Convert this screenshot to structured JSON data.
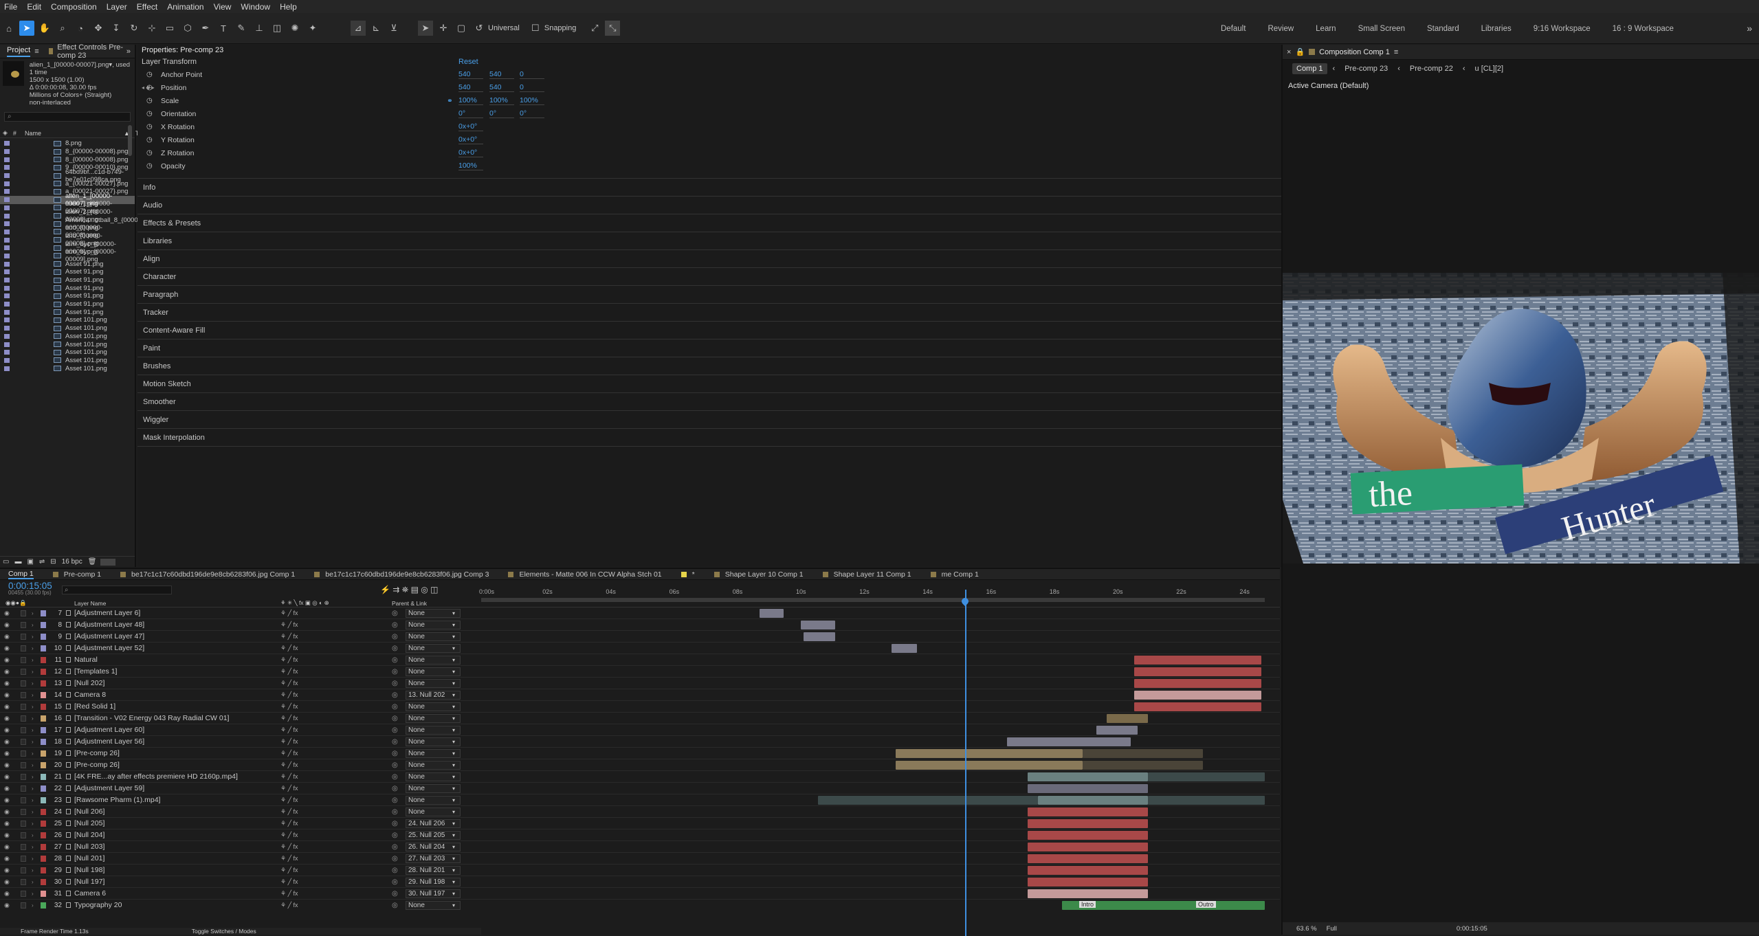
{
  "menu": [
    "File",
    "Edit",
    "Composition",
    "Layer",
    "Effect",
    "Animation",
    "View",
    "Window",
    "Help"
  ],
  "toolbar": {
    "universal": "Universal",
    "snapping": "Snapping"
  },
  "workspaces": [
    "Default",
    "Review",
    "Learn",
    "Small Screen",
    "Standard",
    "Libraries",
    "9:16 Workspace",
    "16 : 9 Workspace"
  ],
  "project": {
    "tab": "Project",
    "tab2": "Effect Controls Pre-comp 23",
    "info": [
      "alien_1_[00000-00007].png▾, used 1 time",
      "1500 x 1500 (1.00)",
      "Δ 0:00:00:08, 30.00 fps",
      "Millions of Colors+ (Straight)",
      "non-interlaced"
    ],
    "search": "",
    "col_name": "Name",
    "col_type": "Type",
    "items": [
      "8.png",
      "8_{00000-00008}.png",
      "8_{00000-00008}.png",
      "9_{00000-00010}.png",
      "64bd9bf...c1d-b749-be7e01c098ca.png",
      "a_{00021-00027}.png",
      "a_{00021-00027}.png",
      "alien_1_[00000-00007].png",
      "alien_1_[00000-00007].png",
      "alien_2_{00000-00008}.png",
      "America...otball_8_{00000-00008}.png",
      "and_{00000-00008}.png",
      "and_{00000-00008}.png",
      "arm_byc_[00000-00009].png",
      "arm_byc_[00000-00009].png",
      "Asset 91.png",
      "Asset 91.png",
      "Asset 91.png",
      "Asset 91.png",
      "Asset 91.png",
      "Asset 91.png",
      "Asset 91.png",
      "Asset 101.png",
      "Asset 101.png",
      "Asset 101.png",
      "Asset 101.png",
      "Asset 101.png",
      "Asset 101.png",
      "Asset 101.png"
    ],
    "selected_index": 7,
    "bpc": "16 bpc"
  },
  "properties": {
    "title": "Properties: Pre-comp 23",
    "group": "Layer Transform",
    "reset": "Reset",
    "rows": [
      {
        "name": "Anchor Point",
        "v": [
          "540",
          "540",
          "0"
        ]
      },
      {
        "name": "Position",
        "v": [
          "540",
          "540",
          "0"
        ]
      },
      {
        "name": "Scale",
        "v": [
          "100%",
          "100%",
          "100%"
        ]
      },
      {
        "name": "Orientation",
        "v": [
          "0°",
          "0°",
          "0°"
        ]
      },
      {
        "name": "X Rotation",
        "v": [
          "0x+0°"
        ]
      },
      {
        "name": "Y Rotation",
        "v": [
          "0x+0°"
        ]
      },
      {
        "name": "Z Rotation",
        "v": [
          "0x+0°"
        ]
      },
      {
        "name": "Opacity",
        "v": [
          "100%"
        ]
      }
    ],
    "sections": [
      "Info",
      "Audio",
      "Effects & Presets",
      "Libraries",
      "Align",
      "Character",
      "Paragraph",
      "Tracker",
      "Content-Aware Fill",
      "Paint",
      "Brushes",
      "Motion Sketch",
      "Smoother",
      "Wiggler",
      "Mask Interpolation"
    ]
  },
  "composition": {
    "tab": "Composition Comp 1",
    "breadcrumbs": [
      "Comp 1",
      "Pre-comp 23",
      "Pre-comp 22",
      "u [CL][2]"
    ],
    "camera": "Active Camera (Default)",
    "text_the": "the",
    "text_hunter": "Hunter",
    "footer_zoom": "63.6 %",
    "footer_res": "Full",
    "footer_time": "0:00:15:05"
  },
  "timeline": {
    "tabs": [
      "Comp 1",
      "Pre-comp 1",
      "be17c1c17c60dbd196de9e8cb6283f06.jpg Comp 1",
      "be17c1c17c60dbd196de9e8cb6283f06.jpg Comp 3",
      "Elements - Matte 006 In CCW Alpha Stch 01",
      "*",
      "Shape Layer 10 Comp 1",
      "Shape Layer 11 Comp 1",
      "me Comp 1"
    ],
    "timecode": "0:00:15:05",
    "frames": "00455 (30.00 fps)",
    "col_layer": "Layer Name",
    "col_parent": "Parent & Link",
    "ruler": [
      "0:00s",
      "02s",
      "04s",
      "06s",
      "08s",
      "10s",
      "12s",
      "14s",
      "16s",
      "18s",
      "20s",
      "22s",
      "24s"
    ],
    "footer": "Frame Render Time 1.13s",
    "footer2": "Toggle Switches / Modes",
    "layers": [
      {
        "n": "7",
        "name": "[Adjustment Layer 6]",
        "parent": "None",
        "c": "#8e8ec8"
      },
      {
        "n": "8",
        "name": "[Adjustment Layer 48]",
        "parent": "None",
        "c": "#8e8ec8"
      },
      {
        "n": "9",
        "name": "[Adjustment Layer 47]",
        "parent": "None",
        "c": "#8e8ec8"
      },
      {
        "n": "10",
        "name": "[Adjustment Layer 52]",
        "parent": "None",
        "c": "#8e8ec8"
      },
      {
        "n": "11",
        "name": "Natural",
        "parent": "None",
        "c": "#b23b3b"
      },
      {
        "n": "12",
        "name": "[Templates 1]",
        "parent": "None",
        "c": "#b23b3b"
      },
      {
        "n": "13",
        "name": "[Null 202]",
        "parent": "None",
        "c": "#b23b3b"
      },
      {
        "n": "14",
        "name": "Camera 8",
        "parent": "13. Null 202",
        "c": "#e09090"
      },
      {
        "n": "15",
        "name": "[Red Solid 1]",
        "parent": "None",
        "c": "#b23b3b"
      },
      {
        "n": "16",
        "name": "[Transition - V02 Energy 043 Ray Radial CW 01]",
        "parent": "None",
        "c": "#c8a36b"
      },
      {
        "n": "17",
        "name": "[Adjustment Layer 60]",
        "parent": "None",
        "c": "#8e8ec8"
      },
      {
        "n": "18",
        "name": "[Adjustment Layer 56]",
        "parent": "None",
        "c": "#8e8ec8"
      },
      {
        "n": "19",
        "name": "[Pre-comp 26]",
        "parent": "None",
        "c": "#c8a36b"
      },
      {
        "n": "20",
        "name": "[Pre-comp 26]",
        "parent": "None",
        "c": "#c8a36b"
      },
      {
        "n": "21",
        "name": "[4K FRE...ay after effects premiere HD 2160p.mp4]",
        "parent": "None",
        "c": "#8cb8b8"
      },
      {
        "n": "22",
        "name": "[Adjustment Layer 59]",
        "parent": "None",
        "c": "#8e8ec8"
      },
      {
        "n": "23",
        "name": "[Rawsome Pharm (1).mp4]",
        "parent": "None",
        "c": "#8cb8b8"
      },
      {
        "n": "24",
        "name": "[Null 206]",
        "parent": "None",
        "c": "#b23b3b"
      },
      {
        "n": "25",
        "name": "[Null 205]",
        "parent": "24. Null 206",
        "c": "#b23b3b"
      },
      {
        "n": "26",
        "name": "[Null 204]",
        "parent": "25. Null 205",
        "c": "#b23b3b"
      },
      {
        "n": "27",
        "name": "[Null 203]",
        "parent": "26. Null 204",
        "c": "#b23b3b"
      },
      {
        "n": "28",
        "name": "[Null 201]",
        "parent": "27. Null 203",
        "c": "#b23b3b"
      },
      {
        "n": "29",
        "name": "[Null 198]",
        "parent": "28. Null 201",
        "c": "#b23b3b"
      },
      {
        "n": "30",
        "name": "[Null 197]",
        "parent": "29. Null 198",
        "c": "#b23b3b"
      },
      {
        "n": "31",
        "name": "Camera 6",
        "parent": "30. Null 197",
        "c": "#e09090"
      },
      {
        "n": "32",
        "name": "Typography 20",
        "parent": "None",
        "c": "#4aa85a"
      }
    ],
    "markers": [
      "Intro",
      "Outro"
    ]
  }
}
